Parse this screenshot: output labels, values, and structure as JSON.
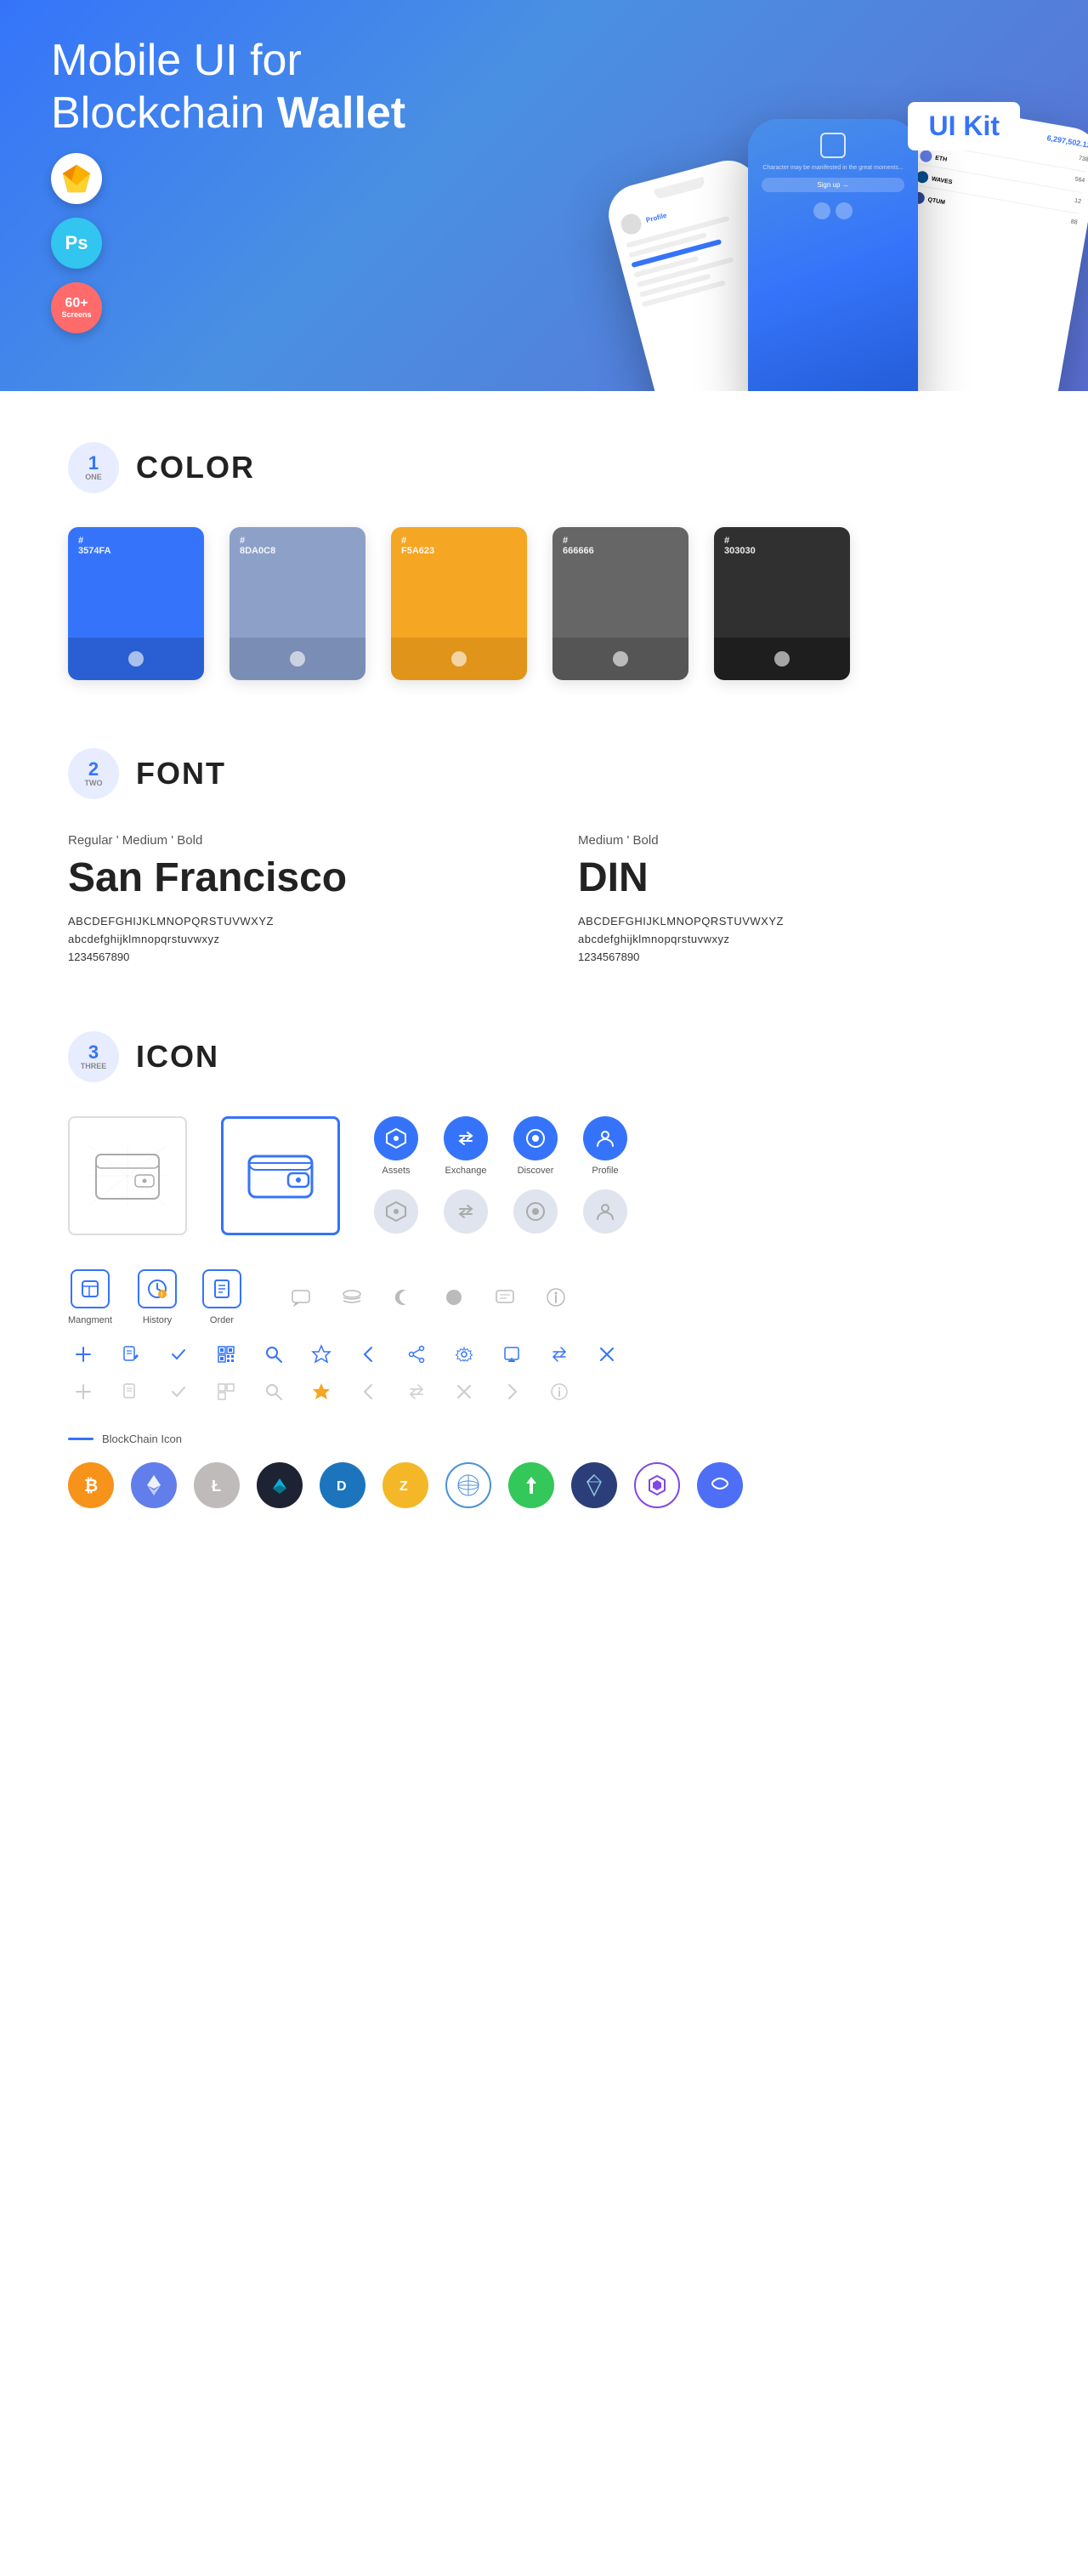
{
  "hero": {
    "title_normal": "Mobile UI for Blockchain ",
    "title_bold": "Wallet",
    "ui_kit_label": "UI Kit",
    "badge_ps": "Ps",
    "badge_screens_num": "60+",
    "badge_screens_text": "Screens"
  },
  "section1": {
    "number": "1",
    "word": "ONE",
    "title": "COLOR",
    "swatches": [
      {
        "hex": "#3574FA",
        "label": "#\n3574FA"
      },
      {
        "hex": "#8DA0C8",
        "label": "#\n8DA0C8"
      },
      {
        "hex": "#F5A623",
        "label": "#\nF5A623"
      },
      {
        "hex": "#666666",
        "label": "#\n666666"
      },
      {
        "hex": "#303030",
        "label": "#\n303030"
      }
    ]
  },
  "section2": {
    "number": "2",
    "word": "TWO",
    "title": "FONT",
    "font1": {
      "styles": "Regular ' Medium ' Bold",
      "name": "San Francisco",
      "uppercase": "ABCDEFGHIJKLMNOPQRSTUVWXYZ",
      "lowercase": "abcdefghijklmnopqrstuvwxyz",
      "numbers": "1234567890"
    },
    "font2": {
      "styles": "Medium ' Bold",
      "name": "DIN",
      "uppercase": "ABCDEFGHIJKLMNOPQRSTUVWXYZ",
      "lowercase": "abcdefghijklmnopqrstuvwxyz",
      "numbers": "1234567890"
    }
  },
  "section3": {
    "number": "3",
    "word": "THREE",
    "title": "ICON",
    "icon_labels": {
      "assets": "Assets",
      "exchange": "Exchange",
      "discover": "Discover",
      "profile": "Profile",
      "management": "Mangment",
      "history": "History",
      "order": "Order"
    },
    "blockchain_label": "BlockChain Icon"
  }
}
